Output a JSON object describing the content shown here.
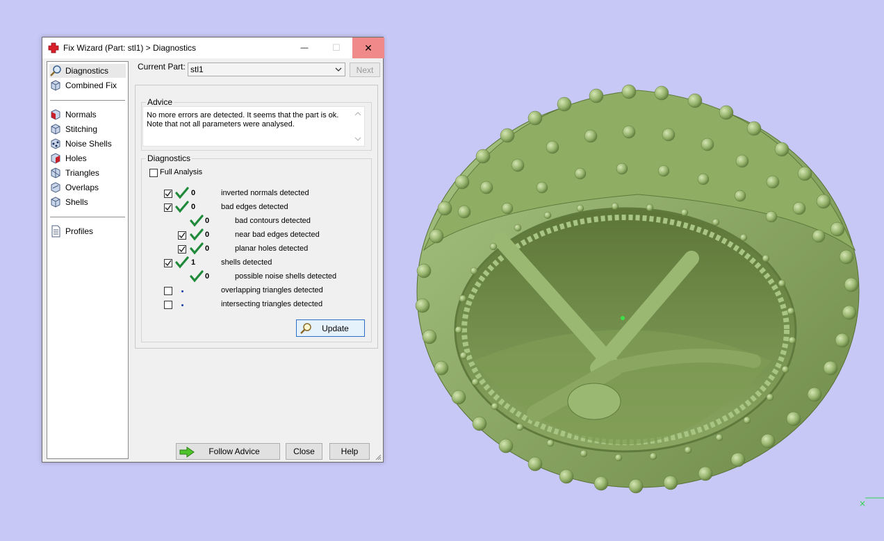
{
  "window": {
    "title": "Fix Wizard (Part: stl1) > Diagnostics",
    "min_glyph": "—",
    "max_glyph": "☐",
    "close_glyph": "✕"
  },
  "nav": {
    "items": [
      {
        "label": "Diagnostics",
        "icon": "magnifier-icon"
      },
      {
        "label": "Combined Fix",
        "icon": "cube-icon"
      },
      {
        "label": "Normals",
        "icon": "normals-cube-icon"
      },
      {
        "label": "Stitching",
        "icon": "stitching-cube-icon"
      },
      {
        "label": "Noise Shells",
        "icon": "noise-shells-icon"
      },
      {
        "label": "Holes",
        "icon": "holes-cube-icon"
      },
      {
        "label": "Triangles",
        "icon": "triangles-icon"
      },
      {
        "label": "Overlaps",
        "icon": "overlaps-icon"
      },
      {
        "label": "Shells",
        "icon": "shells-icon"
      },
      {
        "label": "Profiles",
        "icon": "document-icon"
      }
    ]
  },
  "part": {
    "label": "Current Part:",
    "value": "stl1",
    "next_label": "Next"
  },
  "advice": {
    "title": "Advice",
    "line1": "No more errors are detected. It seems that the part is ok.",
    "line2": "Note that not all parameters were analysed."
  },
  "diagnostics": {
    "title": "Diagnostics",
    "full_analysis_label": "Full Analysis",
    "full_analysis_checked": false,
    "rows": [
      {
        "checked": true,
        "ok": true,
        "count": "0",
        "label": "inverted normals detected"
      },
      {
        "checked": true,
        "ok": true,
        "count": "0",
        "label": "bad edges detected"
      },
      {
        "checked": null,
        "ok": true,
        "count": "0",
        "label": "bad contours detected"
      },
      {
        "checked": true,
        "ok": true,
        "count": "0",
        "label": "near bad edges detected"
      },
      {
        "checked": true,
        "ok": true,
        "count": "0",
        "label": "planar holes detected"
      },
      {
        "checked": true,
        "ok": true,
        "count": "1",
        "label": "shells detected"
      },
      {
        "checked": null,
        "ok": true,
        "count": "0",
        "label": "possible noise shells detected"
      },
      {
        "checked": false,
        "ok": false,
        "count": "",
        "label": "overlapping triangles detected"
      },
      {
        "checked": false,
        "ok": false,
        "count": "",
        "label": "intersecting triangles detected"
      }
    ],
    "update_label": "Update"
  },
  "footer": {
    "follow_label": "Follow Advice",
    "close_label": "Close",
    "help_label": "Help"
  },
  "colors": {
    "viewport_bg": "#c8c8f6",
    "model_green": "#9ab870",
    "check_green": "#1f8a3a",
    "close_hover": "#f08a8a"
  }
}
